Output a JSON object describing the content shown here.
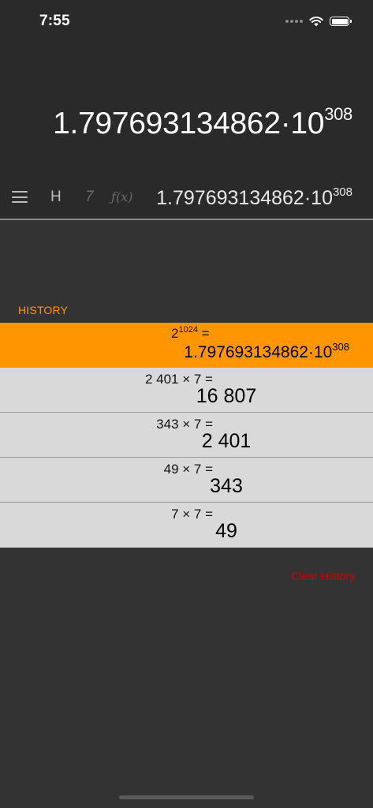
{
  "status_bar": {
    "time": "7:55"
  },
  "display": {
    "mantissa": "1.797693134862·10",
    "exponent": "308"
  },
  "toolbar": {
    "h_label": "H",
    "seven_label": "7",
    "fx_label": "ƒ(x)",
    "mantissa": "1.797693134862·10",
    "exponent": "308"
  },
  "history": {
    "label": "HISTORY",
    "items": [
      {
        "expr_base": "2",
        "expr_exp": "1024",
        "expr_suffix": " =",
        "result_mantissa": "1.797693134862·10",
        "result_exp": "308"
      },
      {
        "expr": "2 401 × 7 =",
        "result": "16 807"
      },
      {
        "expr": "343 × 7 =",
        "result": "2 401"
      },
      {
        "expr": "49 × 7 =",
        "result": "343"
      },
      {
        "expr": "7 × 7 =",
        "result": "49"
      }
    ],
    "clear_label": "Clear History"
  },
  "colors": {
    "accent": "#ff9500",
    "danger": "#d40000",
    "history_bg": "#d9d9d9"
  }
}
